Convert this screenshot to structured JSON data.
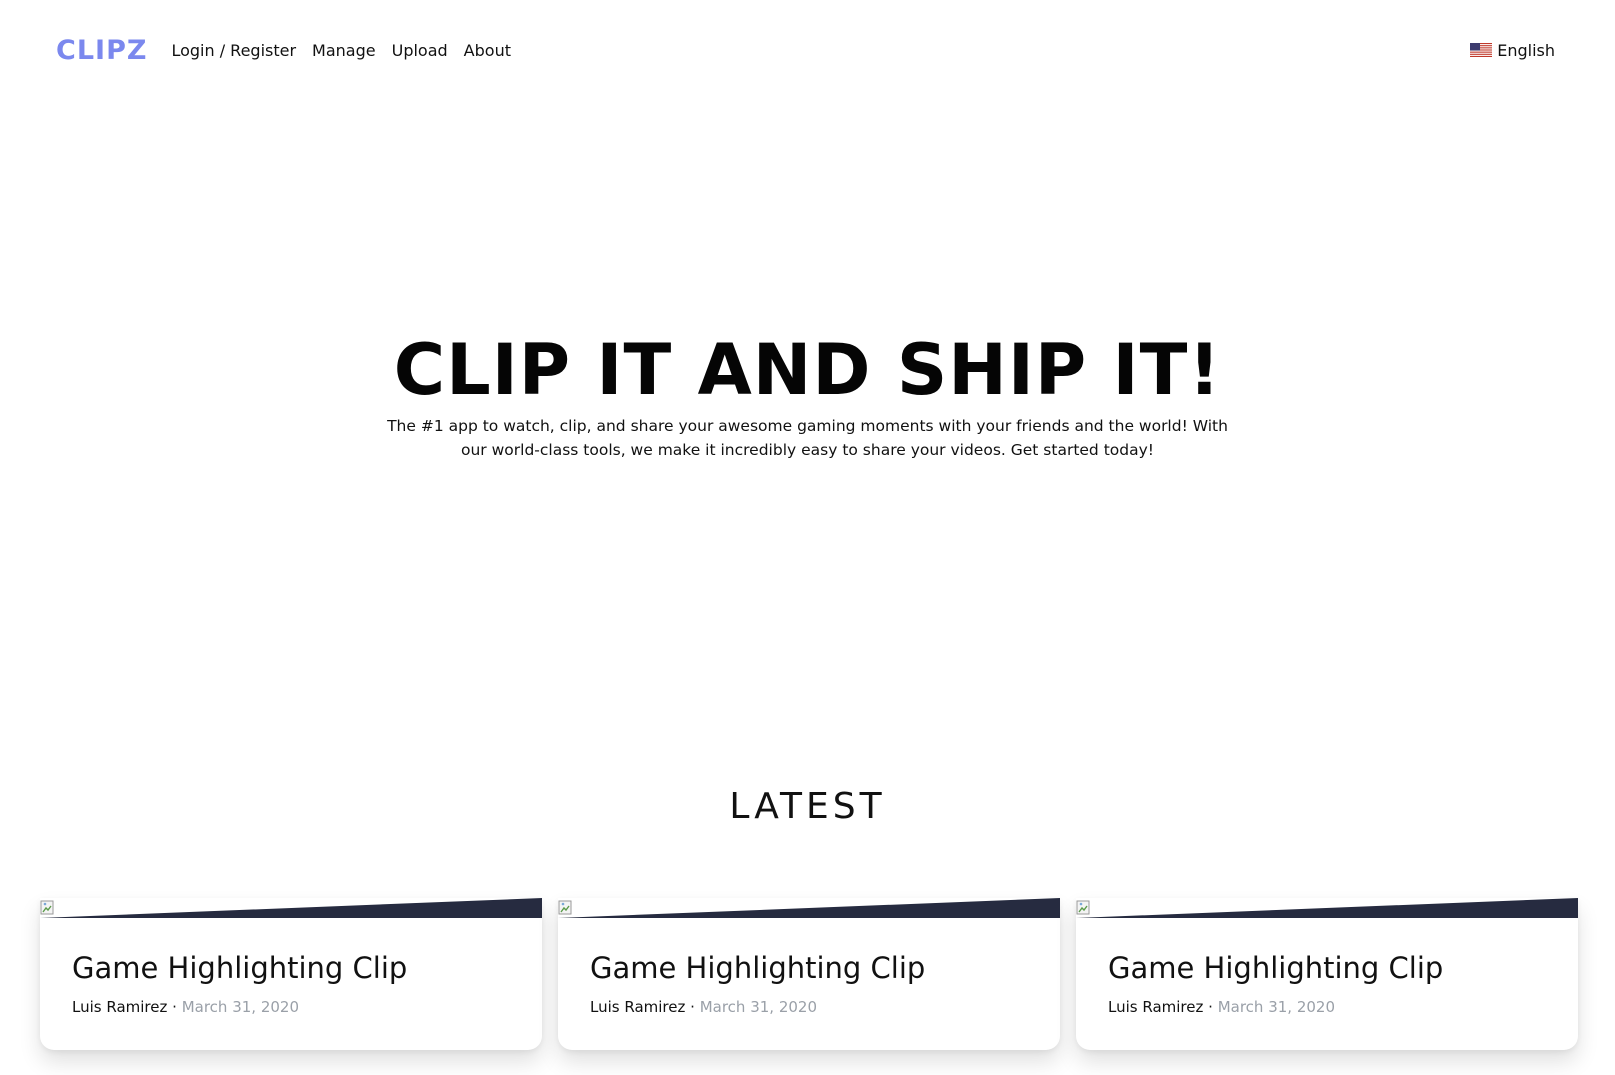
{
  "header": {
    "brand": "CLIPZ",
    "nav": [
      {
        "label": "Login / Register"
      },
      {
        "label": "Manage"
      },
      {
        "label": "Upload"
      },
      {
        "label": "About"
      }
    ],
    "language": {
      "label": "English",
      "flag_icon": "us-flag-icon"
    }
  },
  "hero": {
    "title": "CLIP IT AND SHIP IT!",
    "subtitle": "The #1 app to watch, clip, and share your awesome gaming moments with your friends and the world! With our world-class tools, we make it incredibly easy to share your videos. Get started today!"
  },
  "latest": {
    "heading": "LATEST",
    "clips": [
      {
        "title": "Game Highlighting Clip",
        "author": "Luis Ramirez",
        "separator": "·",
        "date": "March 31, 2020"
      },
      {
        "title": "Game Highlighting Clip",
        "author": "Luis Ramirez",
        "separator": "·",
        "date": "March 31, 2020"
      },
      {
        "title": "Game Highlighting Clip",
        "author": "Luis Ramirez",
        "separator": "·",
        "date": "March 31, 2020"
      }
    ]
  },
  "colors": {
    "brand": "#7b88ee",
    "card_slant": "#262b40",
    "date_text": "#9aa0a8"
  }
}
